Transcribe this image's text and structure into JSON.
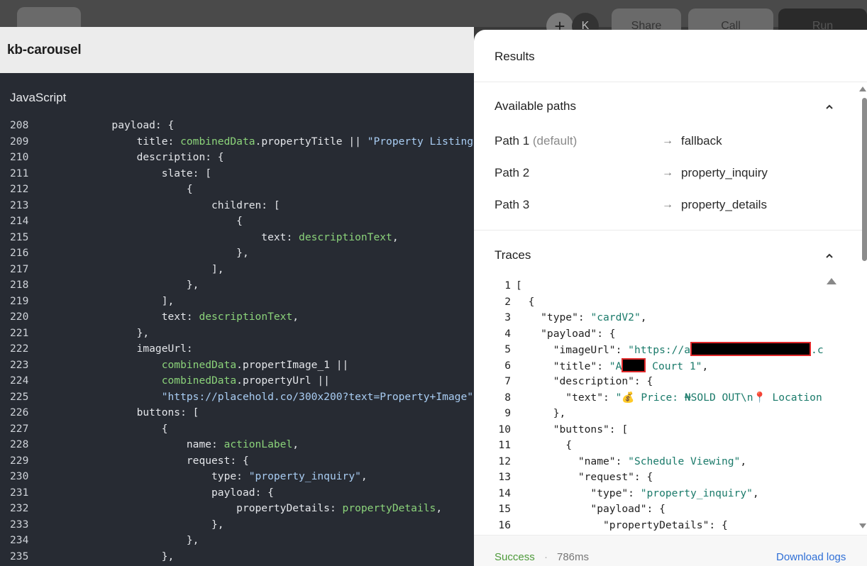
{
  "background": {
    "share_label": "Share",
    "call_label": "Call",
    "run_label": "Run",
    "avatar_letter": "K",
    "plus_label": "+"
  },
  "editor": {
    "title": "kb-carousel",
    "language": "JavaScript",
    "lines": [
      {
        "n": "208",
        "tokens": [
          [
            "k",
            "            payload: {"
          ]
        ]
      },
      {
        "n": "209",
        "tokens": [
          [
            "k",
            "                title: "
          ],
          [
            "v",
            "combinedData"
          ],
          [
            "k",
            ".propertyTitle || "
          ],
          [
            "s",
            "\"Property Listing\""
          ]
        ]
      },
      {
        "n": "210",
        "tokens": [
          [
            "k",
            "                description: {"
          ]
        ]
      },
      {
        "n": "211",
        "tokens": [
          [
            "k",
            "                    slate: ["
          ]
        ]
      },
      {
        "n": "212",
        "tokens": [
          [
            "k",
            "                        {"
          ]
        ]
      },
      {
        "n": "213",
        "tokens": [
          [
            "k",
            "                            children: ["
          ]
        ]
      },
      {
        "n": "214",
        "tokens": [
          [
            "k",
            "                                {"
          ]
        ]
      },
      {
        "n": "215",
        "tokens": [
          [
            "k",
            "                                    text: "
          ],
          [
            "v",
            "descriptionText"
          ],
          [
            "k",
            ","
          ]
        ]
      },
      {
        "n": "216",
        "tokens": [
          [
            "k",
            "                                },"
          ]
        ]
      },
      {
        "n": "217",
        "tokens": [
          [
            "k",
            "                            ],"
          ]
        ]
      },
      {
        "n": "218",
        "tokens": [
          [
            "k",
            "                        },"
          ]
        ]
      },
      {
        "n": "219",
        "tokens": [
          [
            "k",
            "                    ],"
          ]
        ]
      },
      {
        "n": "220",
        "tokens": [
          [
            "k",
            "                    text: "
          ],
          [
            "v",
            "descriptionText"
          ],
          [
            "k",
            ","
          ]
        ]
      },
      {
        "n": "221",
        "tokens": [
          [
            "k",
            "                },"
          ]
        ]
      },
      {
        "n": "222",
        "tokens": [
          [
            "k",
            "                imageUrl:"
          ]
        ]
      },
      {
        "n": "223",
        "tokens": [
          [
            "k",
            "                    "
          ],
          [
            "v",
            "combinedData"
          ],
          [
            "k",
            ".propertImage_1 ||"
          ]
        ]
      },
      {
        "n": "224",
        "tokens": [
          [
            "k",
            "                    "
          ],
          [
            "v",
            "combinedData"
          ],
          [
            "k",
            ".propertyUrl ||"
          ]
        ]
      },
      {
        "n": "225",
        "tokens": [
          [
            "k",
            "                    "
          ],
          [
            "s",
            "\"https://placehold.co/300x200?text=Property+Image\""
          ]
        ]
      },
      {
        "n": "226",
        "tokens": [
          [
            "k",
            "                buttons: ["
          ]
        ]
      },
      {
        "n": "227",
        "tokens": [
          [
            "k",
            "                    {"
          ]
        ]
      },
      {
        "n": "228",
        "tokens": [
          [
            "k",
            "                        name: "
          ],
          [
            "v",
            "actionLabel"
          ],
          [
            "k",
            ","
          ]
        ]
      },
      {
        "n": "229",
        "tokens": [
          [
            "k",
            "                        request: {"
          ]
        ]
      },
      {
        "n": "230",
        "tokens": [
          [
            "k",
            "                            type: "
          ],
          [
            "s",
            "\"property_inquiry\""
          ],
          [
            "k",
            ","
          ]
        ]
      },
      {
        "n": "231",
        "tokens": [
          [
            "k",
            "                            payload: {"
          ]
        ]
      },
      {
        "n": "232",
        "tokens": [
          [
            "k",
            "                                propertyDetails: "
          ],
          [
            "v",
            "propertyDetails"
          ],
          [
            "k",
            ","
          ]
        ]
      },
      {
        "n": "233",
        "tokens": [
          [
            "k",
            "                            },"
          ]
        ]
      },
      {
        "n": "234",
        "tokens": [
          [
            "k",
            "                        },"
          ]
        ]
      },
      {
        "n": "235",
        "tokens": [
          [
            "k",
            "                    },"
          ]
        ]
      }
    ]
  },
  "results": {
    "title": "Results",
    "available_paths": {
      "title": "Available paths",
      "paths": [
        {
          "name": "Path 1",
          "default": "(default)",
          "target": "fallback"
        },
        {
          "name": "Path 2",
          "default": "",
          "target": "property_inquiry"
        },
        {
          "name": "Path 3",
          "default": "",
          "target": "property_details"
        }
      ]
    },
    "traces": {
      "title": "Traces",
      "lines": [
        {
          "n": "1",
          "tokens": [
            [
              "t",
              "["
            ]
          ]
        },
        {
          "n": "2",
          "tokens": [
            [
              "t",
              "  {"
            ]
          ]
        },
        {
          "n": "3",
          "tokens": [
            [
              "t",
              "    \"type\": "
            ],
            [
              "s",
              "\"cardV2\""
            ],
            [
              "t",
              ","
            ]
          ]
        },
        {
          "n": "4",
          "tokens": [
            [
              "t",
              "    \"payload\": {"
            ]
          ]
        },
        {
          "n": "5",
          "tokens": [
            [
              "t",
              "      \"imageUrl\": "
            ],
            [
              "s",
              "\"https://a"
            ],
            [
              "r",
              "170"
            ],
            [
              "s",
              ".c"
            ]
          ]
        },
        {
          "n": "6",
          "tokens": [
            [
              "t",
              "      \"title\": "
            ],
            [
              "s",
              "\"A"
            ],
            [
              "r",
              "34"
            ],
            [
              "s",
              " Court 1\""
            ],
            [
              "t",
              ","
            ]
          ]
        },
        {
          "n": "7",
          "tokens": [
            [
              "t",
              "      \"description\": {"
            ]
          ]
        },
        {
          "n": "8",
          "tokens": [
            [
              "t",
              "        \"text\": "
            ],
            [
              "s",
              "\"💰 Price: ₦SOLD OUT\\n📍 Location"
            ]
          ]
        },
        {
          "n": "9",
          "tokens": [
            [
              "t",
              "      },"
            ]
          ]
        },
        {
          "n": "10",
          "tokens": [
            [
              "t",
              "      \"buttons\": ["
            ]
          ]
        },
        {
          "n": "11",
          "tokens": [
            [
              "t",
              "        {"
            ]
          ]
        },
        {
          "n": "12",
          "tokens": [
            [
              "t",
              "          \"name\": "
            ],
            [
              "s",
              "\"Schedule Viewing\""
            ],
            [
              "t",
              ","
            ]
          ]
        },
        {
          "n": "13",
          "tokens": [
            [
              "t",
              "          \"request\": {"
            ]
          ]
        },
        {
          "n": "14",
          "tokens": [
            [
              "t",
              "            \"type\": "
            ],
            [
              "s",
              "\"property_inquiry\""
            ],
            [
              "t",
              ","
            ]
          ]
        },
        {
          "n": "15",
          "tokens": [
            [
              "t",
              "            \"payload\": {"
            ]
          ]
        },
        {
          "n": "16",
          "tokens": [
            [
              "t",
              "              \"propertyDetails\": {"
            ]
          ]
        }
      ]
    },
    "footer": {
      "status": "Success",
      "separator": "·",
      "duration": "786ms",
      "download_label": "Download logs"
    }
  }
}
